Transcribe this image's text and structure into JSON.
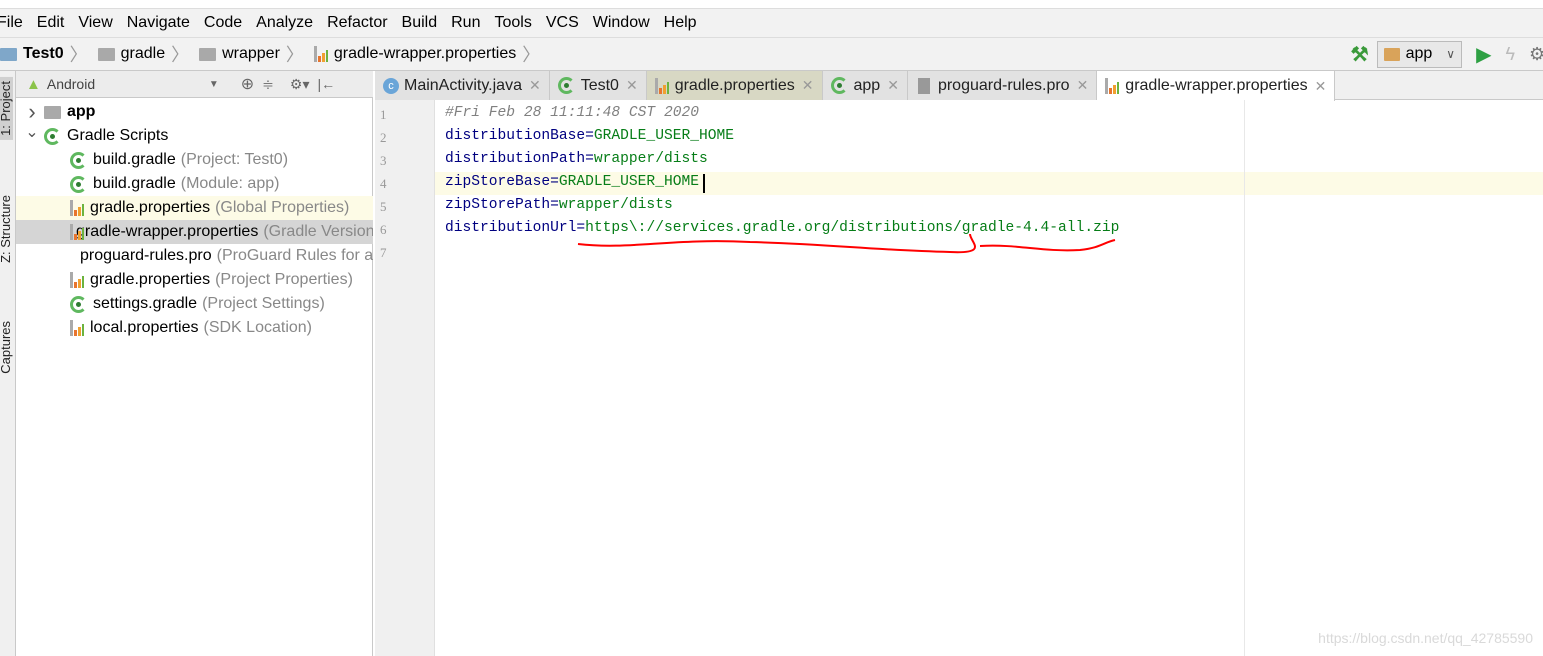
{
  "menu": [
    "File",
    "Edit",
    "View",
    "Navigate",
    "Code",
    "Analyze",
    "Refactor",
    "Build",
    "Run",
    "Tools",
    "VCS",
    "Window",
    "Help"
  ],
  "breadcrumb": [
    "Test0",
    "gradle",
    "wrapper",
    "gradle-wrapper.properties"
  ],
  "toolbar": {
    "run_config": "app",
    "icons": [
      "hammer-icon",
      "run-icon",
      "apply-changes-icon",
      "debug-icon"
    ]
  },
  "side_tabs": [
    "1: Project",
    "Z: Structure",
    "Captures"
  ],
  "project_panel": {
    "view_mode": "Android",
    "items": [
      {
        "label": "app",
        "hint": "",
        "icon": "module-folder-icon",
        "level": 0,
        "expanded": false
      },
      {
        "label": "Gradle Scripts",
        "hint": "",
        "icon": "gradle-icon",
        "level": 0,
        "expanded": true
      },
      {
        "label": "build.gradle",
        "hint": "(Project: Test0)",
        "icon": "gradle-icon",
        "level": 1
      },
      {
        "label": "build.gradle",
        "hint": "(Module: app)",
        "icon": "gradle-icon",
        "level": 1
      },
      {
        "label": "gradle.properties",
        "hint": "(Global Properties)",
        "icon": "properties-icon",
        "level": 1
      },
      {
        "label": "gradle-wrapper.properties",
        "hint": "(Gradle Version)",
        "icon": "properties-icon",
        "level": 1,
        "selected": true
      },
      {
        "label": "proguard-rules.pro",
        "hint": "(ProGuard Rules for app)",
        "icon": "text-file-icon",
        "level": 1
      },
      {
        "label": "gradle.properties",
        "hint": "(Project Properties)",
        "icon": "properties-icon",
        "level": 1
      },
      {
        "label": "settings.gradle",
        "hint": "(Project Settings)",
        "icon": "gradle-icon",
        "level": 1
      },
      {
        "label": "local.properties",
        "hint": "(SDK Location)",
        "icon": "properties-icon",
        "level": 1
      }
    ]
  },
  "tabs": [
    {
      "label": "MainActivity.java",
      "icon": "java-class-icon"
    },
    {
      "label": "Test0",
      "icon": "gradle-icon"
    },
    {
      "label": "gradle.properties",
      "icon": "properties-icon"
    },
    {
      "label": "app",
      "icon": "gradle-icon"
    },
    {
      "label": "proguard-rules.pro",
      "icon": "text-file-icon"
    },
    {
      "label": "gradle-wrapper.properties",
      "icon": "properties-icon",
      "active": true
    }
  ],
  "editor": {
    "lines": [
      {
        "n": "1",
        "key": "",
        "value": "",
        "comment": "#Fri Feb 28 11:11:48 CST 2020"
      },
      {
        "n": "2",
        "key": "distributionBase",
        "value": "GRADLE_USER_HOME"
      },
      {
        "n": "3",
        "key": "distributionPath",
        "value": "wrapper/dists"
      },
      {
        "n": "4",
        "key": "zipStoreBase",
        "value": "GRADLE_USER_HOME"
      },
      {
        "n": "5",
        "key": "zipStorePath",
        "value": "wrapper/dists"
      },
      {
        "n": "6",
        "key": "distributionUrl",
        "value": "https\\://services.gradle.org/distributions/gradle-4.4-all.zip"
      },
      {
        "n": "7",
        "key": "",
        "value": ""
      }
    ],
    "eq": "=",
    "annotation_color": "#ff0000"
  },
  "watermark": "https://blog.csdn.net/qq_42785590"
}
